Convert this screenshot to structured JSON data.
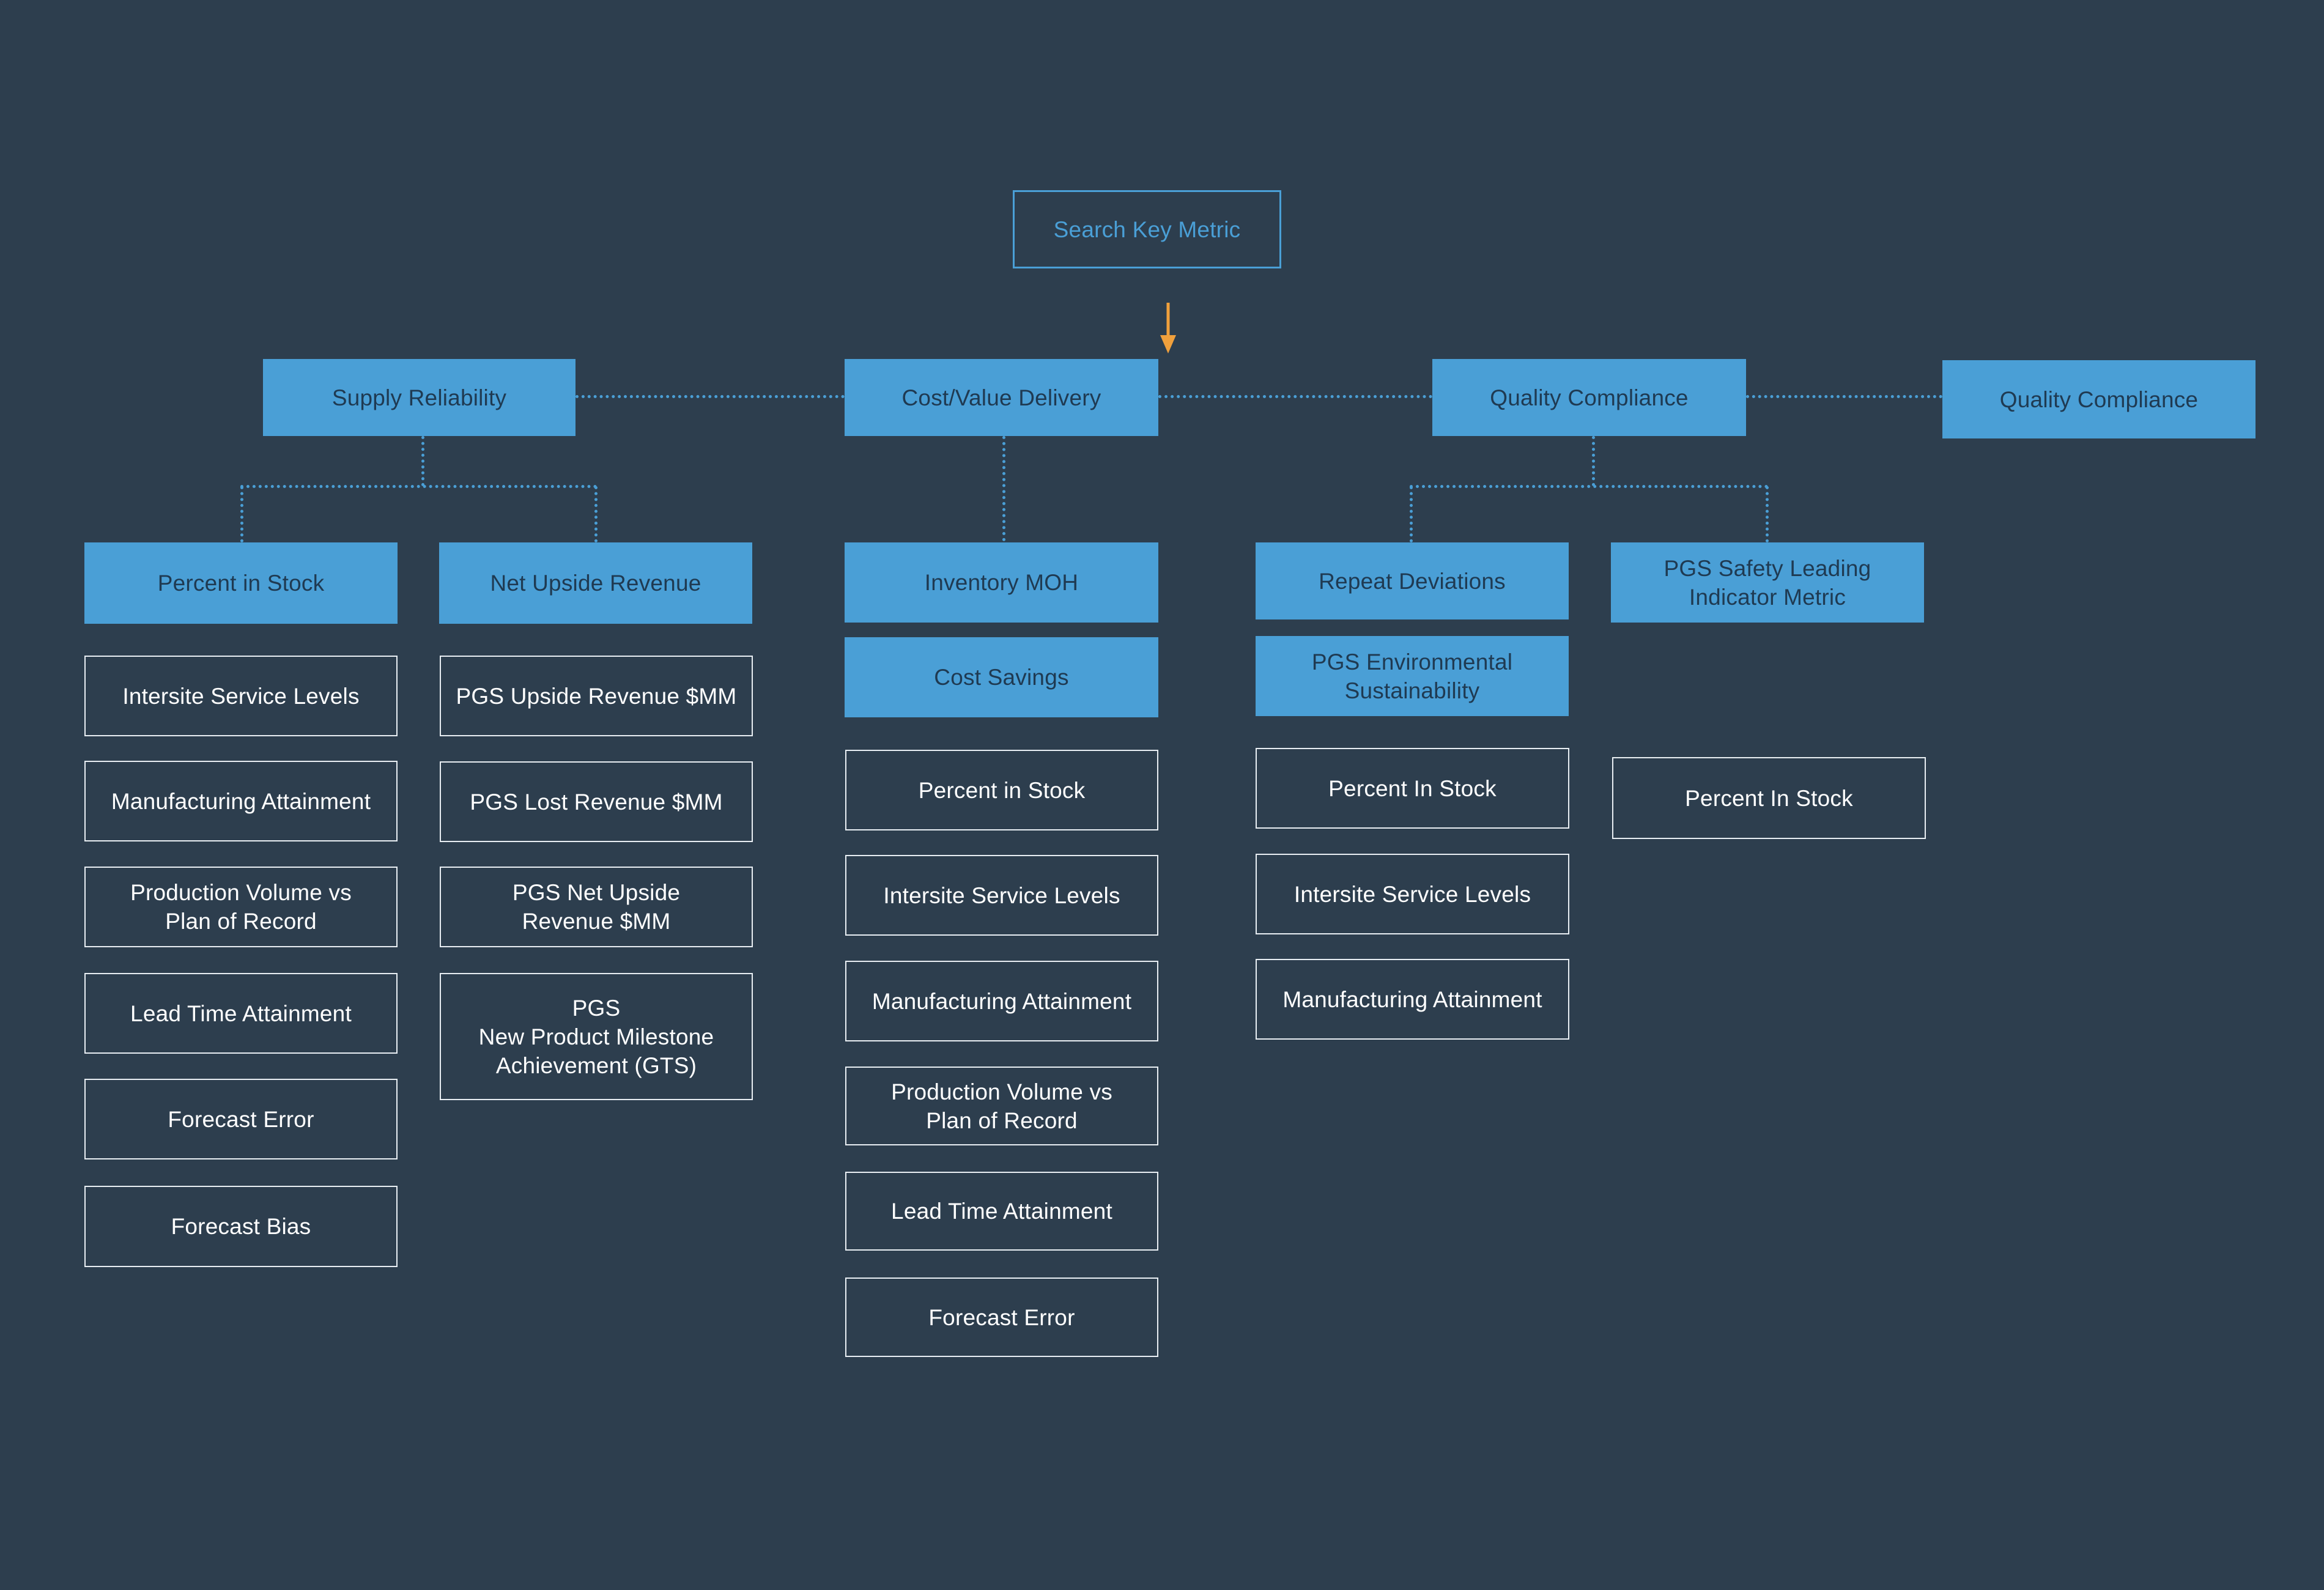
{
  "search": {
    "label": "Search Key Metric"
  },
  "colors": {
    "background": "#2d3e4e",
    "category_fill": "#4a9fd6",
    "category_text": "#1f3a52",
    "metric_outline": "#e8eef3",
    "metric_text": "#ffffff",
    "connector": "#4a9fd6",
    "arrow": "#f0a03c"
  },
  "categories": [
    {
      "label": "Supply Reliability",
      "subgroups": [
        {
          "label": "Percent in Stock",
          "metrics": [
            "Intersite Service Levels",
            "Manufacturing Attainment",
            "Production Volume vs\nPlan of Record",
            "Lead Time Attainment",
            "Forecast Error",
            "Forecast Bias"
          ]
        },
        {
          "label": "Net Upside Revenue",
          "metrics": [
            "PGS Upside Revenue $MM",
            "PGS Lost Revenue $MM",
            "PGS Net Upside\nRevenue $MM",
            "PGS\nNew Product Milestone\nAchievement (GTS)"
          ]
        }
      ]
    },
    {
      "label": "Cost/Value Delivery",
      "subgroups": [
        {
          "label": "Inventory MOH",
          "extra_label": "Cost Savings",
          "metrics": [
            "Percent in Stock",
            "Intersite Service Levels",
            "Manufacturing Attainment",
            "Production Volume vs\nPlan of Record",
            "Lead Time Attainment",
            "Forecast Error"
          ]
        }
      ]
    },
    {
      "label": "Quality Compliance",
      "subgroups": [
        {
          "label": "Repeat Deviations",
          "extra_label": "PGS Environmental\nSustainability",
          "metrics": [
            "Percent In Stock",
            "Intersite Service Levels",
            "Manufacturing Attainment"
          ]
        },
        {
          "label": "PGS Safety Leading\nIndicator Metric",
          "metrics": [
            "Percent In Stock"
          ]
        }
      ]
    },
    {
      "label": "Quality Compliance",
      "subgroups": []
    }
  ]
}
